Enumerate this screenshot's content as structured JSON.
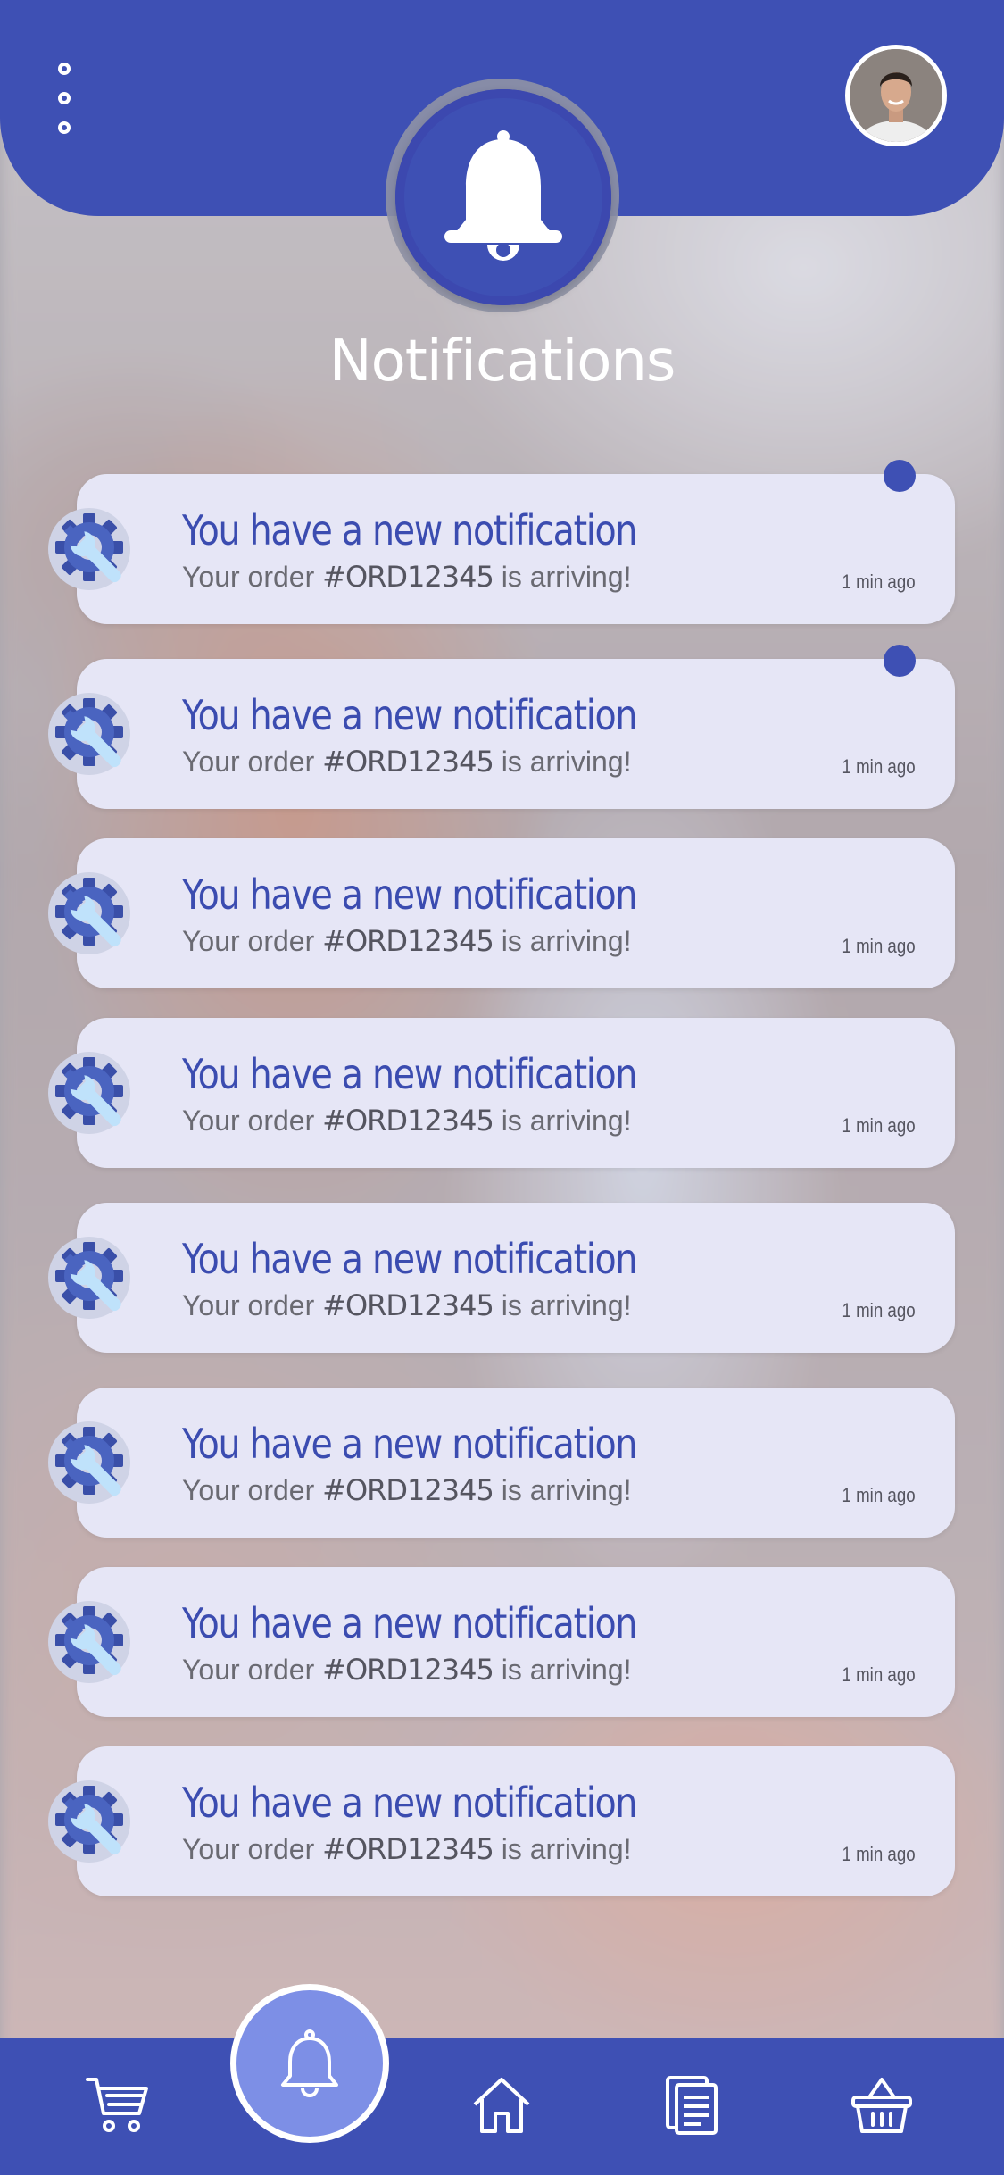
{
  "header": {
    "title": "Notifications",
    "icons": [
      "menu-dots-icon",
      "bell-icon",
      "user-avatar"
    ]
  },
  "notifications": [
    {
      "title": "You have a new notification",
      "body_prefix": "Your order ",
      "order": "#ORD12345",
      "body_suffix": " is arriving!",
      "time": "1 min ago",
      "unread": true
    },
    {
      "title": "You have a new notification",
      "body_prefix": "Your order ",
      "order": "#ORD12345",
      "body_suffix": " is arriving!",
      "time": "1 min ago",
      "unread": true
    },
    {
      "title": "You have a new notification",
      "body_prefix": "Your order ",
      "order": "#ORD12345",
      "body_suffix": " is arriving!",
      "time": "1 min ago",
      "unread": false
    },
    {
      "title": "You have a new notification",
      "body_prefix": "Your order ",
      "order": "#ORD12345",
      "body_suffix": " is arriving!",
      "time": "1 min ago",
      "unread": false
    },
    {
      "title": "You have a new notification",
      "body_prefix": "Your order ",
      "order": "#ORD12345",
      "body_suffix": " is arriving!",
      "time": "1 min ago",
      "unread": false
    },
    {
      "title": "You have a new notification",
      "body_prefix": "Your order ",
      "order": "#ORD12345",
      "body_suffix": " is arriving!",
      "time": "1 min ago",
      "unread": false
    },
    {
      "title": "You have a new notification",
      "body_prefix": "Your order ",
      "order": "#ORD12345",
      "body_suffix": " is arriving!",
      "time": "1 min ago",
      "unread": false
    },
    {
      "title": "You have a new notification",
      "body_prefix": "Your order ",
      "order": "#ORD12345",
      "body_suffix": " is arriving!",
      "time": "1 min ago",
      "unread": false
    }
  ],
  "bottom_nav": {
    "items": [
      {
        "icon": "cart-icon",
        "active": false
      },
      {
        "icon": "bell-icon",
        "active": true
      },
      {
        "icon": "home-icon",
        "active": false
      },
      {
        "icon": "documents-icon",
        "active": false
      },
      {
        "icon": "basket-icon",
        "active": false
      }
    ]
  },
  "colors": {
    "primary": "#3e50b4",
    "card": "#e6e6f6",
    "active_nav": "#7d8fe6",
    "title_text": "#3b4cb0"
  }
}
